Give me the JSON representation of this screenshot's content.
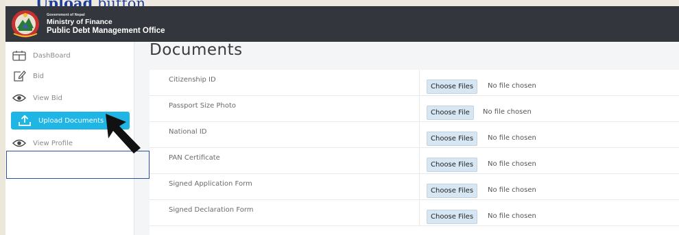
{
  "caption": {
    "bold": "Upload",
    "rest": " button."
  },
  "header": {
    "gov_line": "Government of Nepal",
    "ministry": "Ministry of Finance",
    "office": "Public Debt Management Office"
  },
  "sidebar": {
    "items": [
      {
        "label": "DashBoard",
        "icon": "dashboard-icon"
      },
      {
        "label": "Bid",
        "icon": "edit-icon"
      },
      {
        "label": "View Bid",
        "icon": "eye-icon"
      },
      {
        "label": "Upload Documents",
        "icon": "upload-icon",
        "active": true
      },
      {
        "label": "View Profile",
        "icon": "eye-icon"
      }
    ]
  },
  "main": {
    "title": "Documents",
    "rows": [
      {
        "label": "Citizenship ID",
        "button": "Choose Files",
        "status": "No file chosen"
      },
      {
        "label": "Passport Size Photo",
        "button": "Choose File",
        "status": "No file chosen"
      },
      {
        "label": "National ID",
        "button": "Choose Files",
        "status": "No file chosen"
      },
      {
        "label": "PAN Certificate",
        "button": "Choose Files",
        "status": "No file chosen"
      },
      {
        "label": "Signed Application Form",
        "button": "Choose Files",
        "status": "No file chosen"
      },
      {
        "label": "Signed Declaration Form",
        "button": "Choose Files",
        "status": "No file chosen"
      }
    ]
  },
  "colors": {
    "header_bg": "#33363c",
    "active_nav": "#1fb6e5",
    "caption_blue": "#1f3f9a",
    "file_button_bg": "#d6e6f2"
  }
}
